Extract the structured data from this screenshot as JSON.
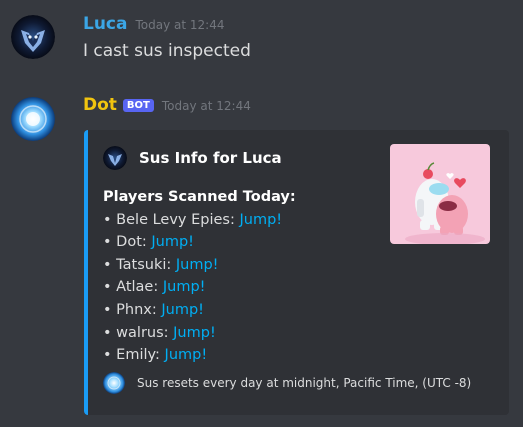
{
  "messages": [
    {
      "username": "Luca",
      "timestamp": "Today at 12:44",
      "text": "I cast sus inspected"
    },
    {
      "username": "Dot",
      "bot_badge": "BOT",
      "timestamp": "Today at 12:44",
      "embed": {
        "author": "Sus Info for Luca",
        "field_title": "Players Scanned Today:",
        "players": [
          {
            "bullet": "•",
            "name": "Bele Levy Epies:",
            "link": "Jump!"
          },
          {
            "bullet": "•",
            "name": "Dot:",
            "link": "Jump!"
          },
          {
            "bullet": "•",
            "name": "Tatsuki:",
            "link": "Jump!"
          },
          {
            "bullet": "•",
            "name": "Atlae:",
            "link": "Jump!"
          },
          {
            "bullet": "•",
            "name": "Phnx:",
            "link": "Jump!"
          },
          {
            "bullet": "•",
            "name": "walrus:",
            "link": "Jump!"
          },
          {
            "bullet": "•",
            "name": "Emily:",
            "link": "Jump!"
          }
        ],
        "footer": "Sus resets every day at midnight, Pacific Time, (UTC -8)"
      }
    }
  ],
  "colors": {
    "background": "#36393f",
    "embed_background": "#2f3136",
    "embed_accent": "#1a9cf5",
    "luca_name": "#3ba6e6",
    "dot_name": "#f1c40f",
    "bot_badge": "#5865f2",
    "link": "#00aff4",
    "timestamp": "#72767d"
  },
  "icons": {
    "luca_avatar": "dark-blue-mask-avatar",
    "dot_avatar": "glowing-blue-orb-avatar",
    "embed_thumbnail": "among-us-crewmates-hug-image",
    "footer_icon": "glowing-blue-orb-icon"
  }
}
